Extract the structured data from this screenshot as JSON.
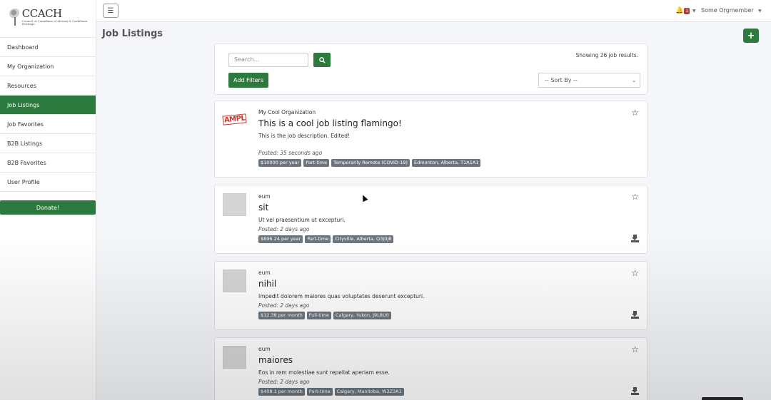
{
  "logo": {
    "brand": "CCACH",
    "subtitle": "Council of Canadians of African & Caribbean Heritage"
  },
  "sidebar": {
    "items": [
      {
        "label": "Dashboard",
        "active": false
      },
      {
        "label": "My Organization",
        "active": false
      },
      {
        "label": "Resources",
        "active": false
      },
      {
        "label": "Job Listings",
        "active": true
      },
      {
        "label": "Job Favorites",
        "active": false
      },
      {
        "label": "B2B Listings",
        "active": false
      },
      {
        "label": "B2B Favorites",
        "active": false
      },
      {
        "label": "User Profile",
        "active": false
      }
    ],
    "donate_label": "Donate!"
  },
  "topbar": {
    "menu_icon": "hamburger-icon",
    "notification_count": "1",
    "user_name": "Some Orgmember"
  },
  "page": {
    "title": "Job Listings",
    "add_label": "+"
  },
  "search": {
    "placeholder": "Search...",
    "button_icon": "search-icon",
    "results_text": "Showing 26 job results.",
    "filters_label": "Add Filters",
    "sort_value": "-- Sort By --"
  },
  "listings": [
    {
      "org": "My Cool Organization",
      "title": "This is a cool job listing flamingo!",
      "description": "This is the job description. Edited!",
      "posted": "Posted: 35 seconds ago",
      "tags": [
        "$10000 per year",
        "Part-time",
        "Temporarily Remote (COVID-19)",
        "Edmonton, Alberta, T1A1A1"
      ],
      "thumb_text": "AMPL",
      "has_download": false
    },
    {
      "org": "eum",
      "title": "sit",
      "description": "Ut vel praesentium ut excepturi.",
      "posted": "Posted: 2 days ago",
      "tags": [
        "$896.24 per year",
        "Part-time",
        "Cityville, Alberta, Q3J0J8"
      ],
      "has_download": true
    },
    {
      "org": "eum",
      "title": "nihil",
      "description": "Impedit dolorem maiores quas voluptates deserunt excepturi.",
      "posted": "Posted: 2 days ago",
      "tags": [
        "$12.38 per month",
        "Full-time",
        "Calgary, Yukon, J9L8U0"
      ],
      "has_download": true
    },
    {
      "org": "eum",
      "title": "maiores",
      "description": "Eos in rem molestiae sunt repellat aperiam esse.",
      "posted": "Posted: 2 days ago",
      "tags": [
        "$408.1 per month",
        "Part-time",
        "Calgary, Manitoba, W3Z3A1"
      ],
      "has_download": true
    }
  ],
  "colors": {
    "primary": "#2c7a3e",
    "tag": "#6c757d",
    "badge": "#c0392b"
  }
}
